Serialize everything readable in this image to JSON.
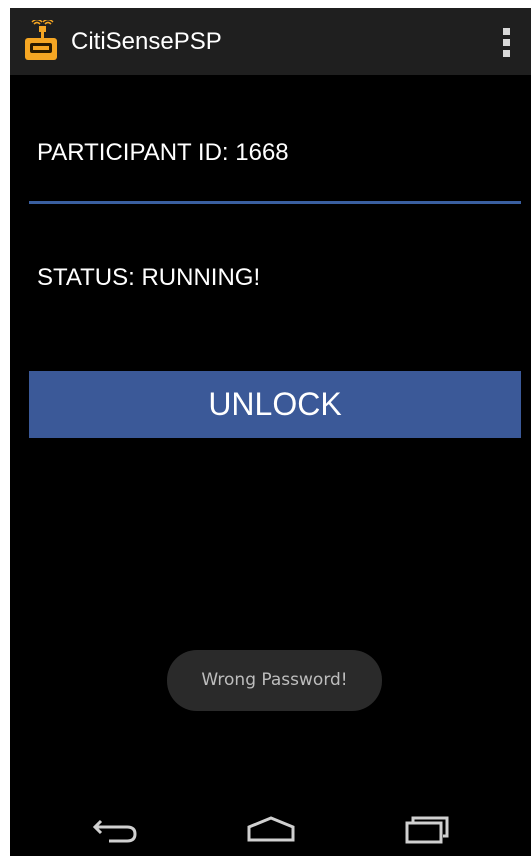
{
  "app": {
    "title": "CitiSensePSP",
    "icon": "robot-antenna-icon",
    "menu_icon": "overflow-menu-icon"
  },
  "main": {
    "participant_label": "PARTICIPANT ID: 1668",
    "status_label": "STATUS: RUNNING!",
    "unlock_label": "UNLOCK"
  },
  "toast": {
    "message": "Wrong Password!"
  },
  "navigation": {
    "back_icon": "back-arrow-icon",
    "home_icon": "home-icon",
    "recents_icon": "recent-apps-icon"
  },
  "colors": {
    "background": "#000000",
    "action_bar": "#1f1f1f",
    "accent": "#3b5998",
    "icon_orange": "#f5a623",
    "text": "#ffffff",
    "toast_text": "#bdbdbd"
  }
}
